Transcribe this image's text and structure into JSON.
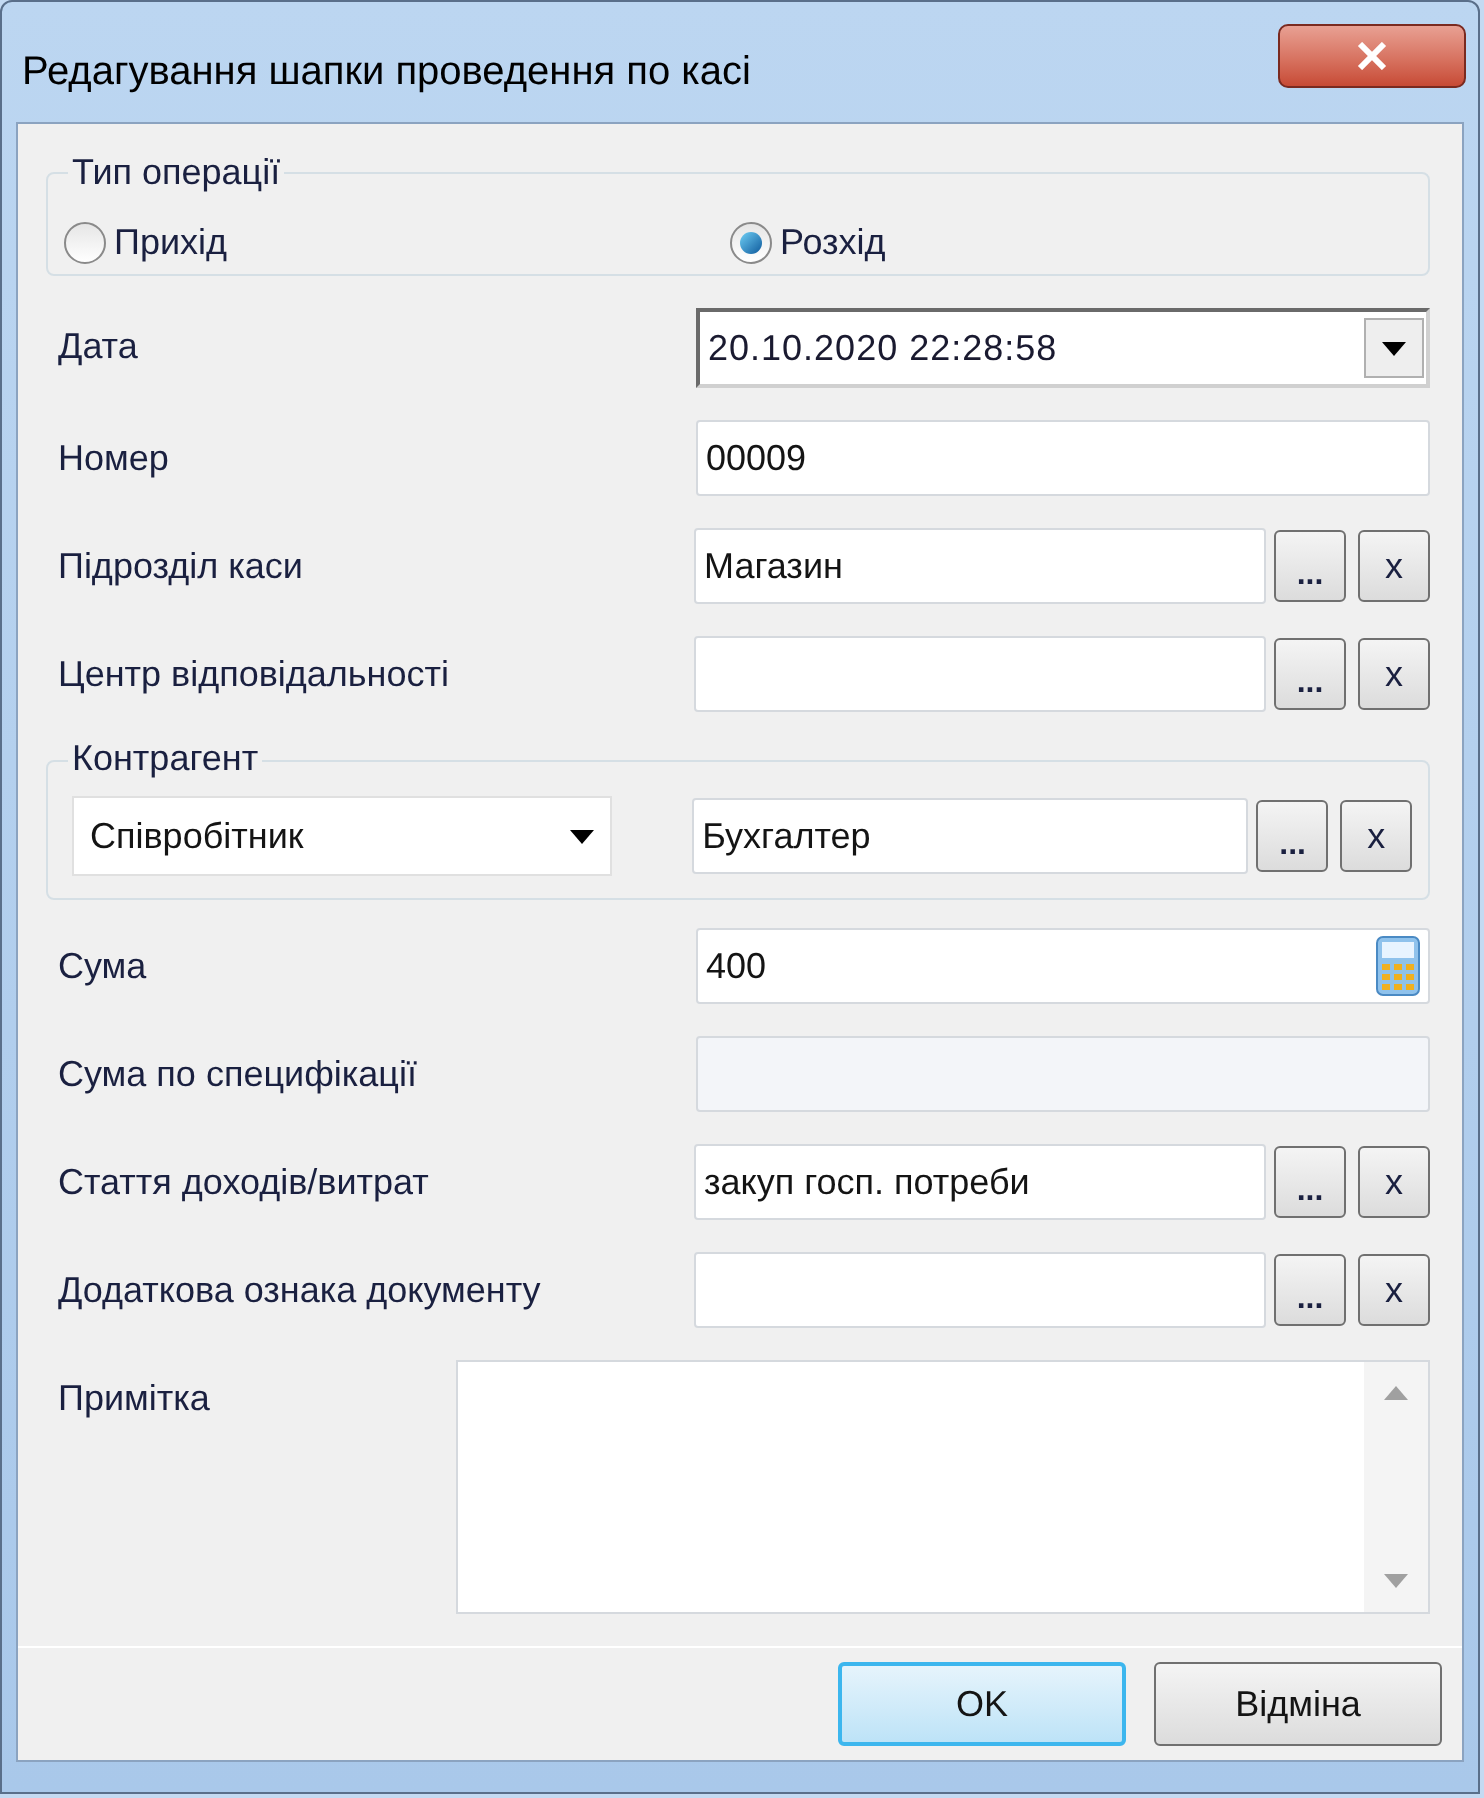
{
  "window": {
    "title": "Редагування шапки проведення по касі"
  },
  "operation_type": {
    "label": "Тип операції",
    "options": [
      {
        "label": "Прихід",
        "selected": false
      },
      {
        "label": "Розхід",
        "selected": true
      }
    ]
  },
  "fields": [
    {
      "kind": "datetime",
      "label": "Дата",
      "value": "20.10.2020 22:28:58"
    },
    {
      "kind": "text",
      "label": "Номер",
      "value": "00009"
    },
    {
      "kind": "lookup",
      "label": "Підрозділ каси",
      "value": "Магазин",
      "browse": "...",
      "clear": "x"
    },
    {
      "kind": "lookup",
      "label": "Центр відповідальності",
      "browse": "...",
      "clear": "x"
    },
    {
      "kind": "group",
      "label": "Контрагент",
      "type_value": "Співробітник",
      "value": "Бухгалтер",
      "browse": "...",
      "clear": "x"
    },
    {
      "kind": "calculator",
      "label": "Сума",
      "value": "400"
    },
    {
      "kind": "readonly",
      "label": "Сума по специфікації"
    },
    {
      "kind": "lookup",
      "label": "Стаття доходів/витрат",
      "value": "закуп госп. потреби",
      "browse": "...",
      "clear": "x"
    },
    {
      "kind": "lookup",
      "label": "Додаткова ознака документу",
      "browse": "...",
      "clear": "x"
    },
    {
      "kind": "memo",
      "label": "Примітка"
    }
  ],
  "buttons": [
    {
      "label": "OK",
      "default": true
    },
    {
      "label": "Відміна",
      "default": false
    }
  ]
}
